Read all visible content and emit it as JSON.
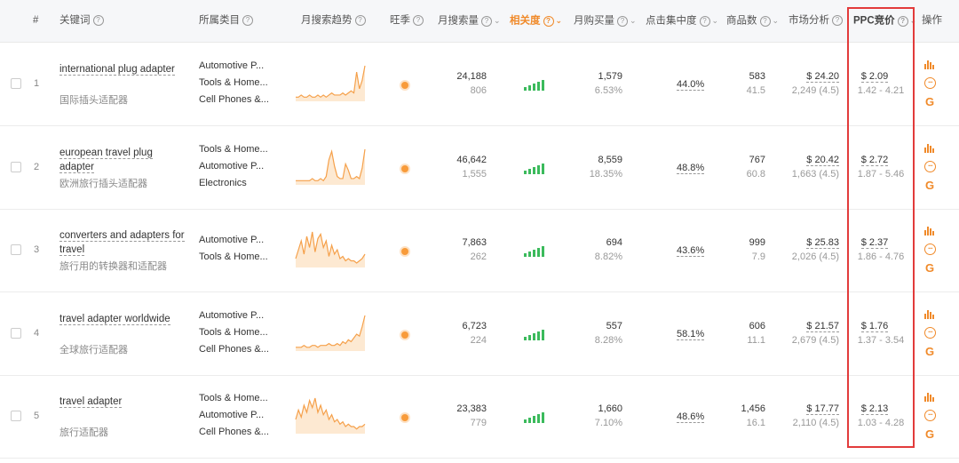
{
  "headers": {
    "index": "#",
    "keyword": "关键词",
    "category": "所属类目",
    "trend": "月搜索趋势",
    "season": "旺季",
    "search_volume": "月搜索量",
    "relevance": "相关度",
    "purchases": "月购买量",
    "click_concentration": "点击集中度",
    "products": "商品数",
    "market": "市场分析",
    "ppc": "PPC竞价",
    "actions": "操作"
  },
  "rows": [
    {
      "index": "1",
      "keyword": "international plug adapter",
      "keyword_cn": "国际插头适配器",
      "categories": [
        "Automotive P...",
        "Tools & Home...",
        "Cell Phones &..."
      ],
      "search": "24,188",
      "search_sub": "806",
      "purchases": "1,579",
      "purchases_sub": "6.53%",
      "click": "44.0%",
      "products": "583",
      "products_sub": "41.5",
      "market": "$ 24.20",
      "market_sub": "2,249 (4.5)",
      "ppc": "$ 2.09",
      "ppc_range": "1.42 - 4.21",
      "trend": [
        2,
        2,
        3,
        2,
        2,
        3,
        2,
        2,
        3,
        2,
        3,
        2,
        3,
        4,
        3,
        3,
        3,
        4,
        3,
        4,
        5,
        4,
        14,
        6,
        10,
        17
      ]
    },
    {
      "index": "2",
      "keyword": "european travel plug adapter",
      "keyword_cn": "欧洲旅行插头适配器",
      "categories": [
        "Tools & Home...",
        "Automotive P...",
        "Electronics"
      ],
      "search": "46,642",
      "search_sub": "1,555",
      "purchases": "8,559",
      "purchases_sub": "18.35%",
      "click": "48.8%",
      "products": "767",
      "products_sub": "60.8",
      "market": "$ 20.42",
      "market_sub": "1,663 (4.5)",
      "ppc": "$ 2.72",
      "ppc_range": "1.87 - 5.46",
      "trend": [
        2,
        2,
        2,
        2,
        2,
        2,
        3,
        2,
        2,
        3,
        2,
        4,
        12,
        16,
        9,
        4,
        3,
        3,
        10,
        7,
        3,
        3,
        4,
        3,
        8,
        17
      ]
    },
    {
      "index": "3",
      "keyword": "converters and adapters for travel",
      "keyword_cn": "旅行用的转换器和适配器",
      "categories": [
        "Automotive P...",
        "Tools & Home..."
      ],
      "search": "7,863",
      "search_sub": "262",
      "purchases": "694",
      "purchases_sub": "8.82%",
      "click": "43.6%",
      "products": "999",
      "products_sub": "7.9",
      "market": "$ 25.83",
      "market_sub": "2,026 (4.5)",
      "ppc": "$ 2.37",
      "ppc_range": "1.86 - 4.76",
      "trend": [
        4,
        8,
        12,
        6,
        14,
        9,
        16,
        7,
        13,
        15,
        9,
        12,
        5,
        10,
        6,
        8,
        4,
        5,
        3,
        4,
        3,
        3,
        2,
        3,
        4,
        6
      ]
    },
    {
      "index": "4",
      "keyword": "travel adapter worldwide",
      "keyword_cn": "全球旅行适配器",
      "categories": [
        "Automotive P...",
        "Tools & Home...",
        "Cell Phones &..."
      ],
      "search": "6,723",
      "search_sub": "224",
      "purchases": "557",
      "purchases_sub": "8.28%",
      "click": "58.1%",
      "products": "606",
      "products_sub": "11.1",
      "market": "$ 21.57",
      "market_sub": "2,679 (4.5)",
      "ppc": "$ 1.76",
      "ppc_range": "1.37 - 3.54",
      "trend": [
        2,
        2,
        2,
        3,
        2,
        2,
        3,
        3,
        2,
        3,
        3,
        3,
        4,
        3,
        3,
        4,
        3,
        5,
        4,
        6,
        5,
        7,
        9,
        8,
        13,
        19
      ]
    },
    {
      "index": "5",
      "keyword": "travel adapter",
      "keyword_cn": "旅行适配器",
      "categories": [
        "Tools & Home...",
        "Automotive P...",
        "Cell Phones &..."
      ],
      "search": "23,383",
      "search_sub": "779",
      "purchases": "1,660",
      "purchases_sub": "7.10%",
      "click": "48.6%",
      "products": "1,456",
      "products_sub": "16.1",
      "market": "$ 17.77",
      "market_sub": "2,110 (4.5)",
      "ppc": "$ 2.13",
      "ppc_range": "1.03 - 4.28",
      "trend": [
        6,
        10,
        7,
        12,
        9,
        14,
        11,
        15,
        9,
        12,
        8,
        10,
        6,
        8,
        5,
        6,
        4,
        5,
        3,
        4,
        3,
        3,
        2,
        3,
        3,
        4
      ]
    }
  ],
  "colors": {
    "accent": "#f08a2a",
    "green": "#3bba5c",
    "highlight": "#e23b3b"
  }
}
